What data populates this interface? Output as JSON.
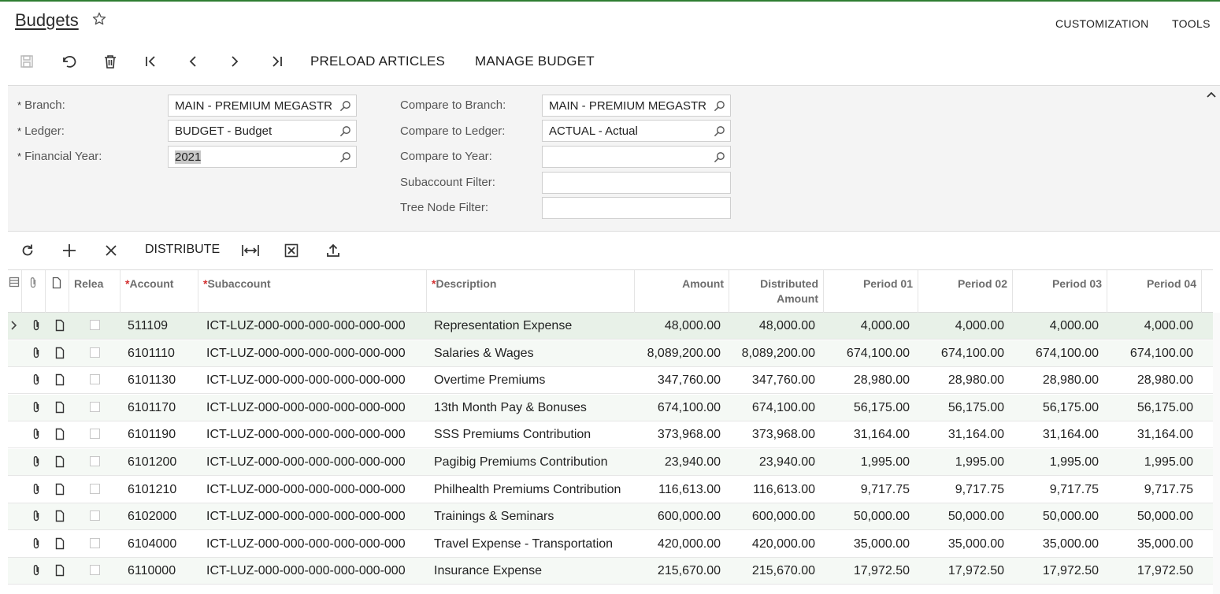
{
  "header": {
    "title": "Budgets",
    "customization": "CUSTOMIZATION",
    "tools": "TOOLS"
  },
  "toolbar": {
    "preload": "PRELOAD ARTICLES",
    "manage": "MANAGE BUDGET"
  },
  "form": {
    "branch_label": "Branch:",
    "branch_value": "MAIN - PREMIUM MEGASTR",
    "ledger_label": "Ledger:",
    "ledger_value": "BUDGET - Budget",
    "year_label": "Financial Year:",
    "year_value": "2021",
    "cmp_branch_label": "Compare to Branch:",
    "cmp_branch_value": "MAIN - PREMIUM MEGASTR",
    "cmp_ledger_label": "Compare to Ledger:",
    "cmp_ledger_value": "ACTUAL - Actual",
    "cmp_year_label": "Compare to Year:",
    "cmp_year_value": "",
    "subacct_label": "Subaccount Filter:",
    "subacct_value": "",
    "tree_label": "Tree Node Filter:",
    "tree_value": "",
    "required_mark": "*"
  },
  "grid": {
    "distribute": "DISTRIBUTE",
    "columns": {
      "released": "Relea",
      "account": "Account",
      "subaccount": "Subaccount",
      "description": "Description",
      "amount": "Amount",
      "distributed_1": "Distributed",
      "distributed_2": "Amount",
      "p01": "Period 01",
      "p02": "Period 02",
      "p03": "Period 03",
      "p04": "Period 04",
      "required_mark": "*"
    },
    "rows": [
      {
        "account": "511109",
        "sub": "ICT-LUZ-000-000-000-000-000-000",
        "desc": "Representation Expense",
        "amount": "48,000.00",
        "dist": "48,000.00",
        "p1": "4,000.00",
        "p2": "4,000.00",
        "p3": "4,000.00",
        "p4": "4,000.00"
      },
      {
        "account": "6101110",
        "sub": "ICT-LUZ-000-000-000-000-000-000",
        "desc": "Salaries & Wages",
        "amount": "8,089,200.00",
        "dist": "8,089,200.00",
        "p1": "674,100.00",
        "p2": "674,100.00",
        "p3": "674,100.00",
        "p4": "674,100.00"
      },
      {
        "account": "6101130",
        "sub": "ICT-LUZ-000-000-000-000-000-000",
        "desc": "Overtime Premiums",
        "amount": "347,760.00",
        "dist": "347,760.00",
        "p1": "28,980.00",
        "p2": "28,980.00",
        "p3": "28,980.00",
        "p4": "28,980.00"
      },
      {
        "account": "6101170",
        "sub": "ICT-LUZ-000-000-000-000-000-000",
        "desc": "13th Month Pay & Bonuses",
        "amount": "674,100.00",
        "dist": "674,100.00",
        "p1": "56,175.00",
        "p2": "56,175.00",
        "p3": "56,175.00",
        "p4": "56,175.00"
      },
      {
        "account": "6101190",
        "sub": "ICT-LUZ-000-000-000-000-000-000",
        "desc": "SSS Premiums Contribution",
        "amount": "373,968.00",
        "dist": "373,968.00",
        "p1": "31,164.00",
        "p2": "31,164.00",
        "p3": "31,164.00",
        "p4": "31,164.00"
      },
      {
        "account": "6101200",
        "sub": "ICT-LUZ-000-000-000-000-000-000",
        "desc": "Pagibig Premiums Contribution",
        "amount": "23,940.00",
        "dist": "23,940.00",
        "p1": "1,995.00",
        "p2": "1,995.00",
        "p3": "1,995.00",
        "p4": "1,995.00"
      },
      {
        "account": "6101210",
        "sub": "ICT-LUZ-000-000-000-000-000-000",
        "desc": "Philhealth Premiums Contribution",
        "amount": "116,613.00",
        "dist": "116,613.00",
        "p1": "9,717.75",
        "p2": "9,717.75",
        "p3": "9,717.75",
        "p4": "9,717.75"
      },
      {
        "account": "6102000",
        "sub": "ICT-LUZ-000-000-000-000-000-000",
        "desc": "Trainings & Seminars",
        "amount": "600,000.00",
        "dist": "600,000.00",
        "p1": "50,000.00",
        "p2": "50,000.00",
        "p3": "50,000.00",
        "p4": "50,000.00"
      },
      {
        "account": "6104000",
        "sub": "ICT-LUZ-000-000-000-000-000-000",
        "desc": "Travel Expense - Transportation",
        "amount": "420,000.00",
        "dist": "420,000.00",
        "p1": "35,000.00",
        "p2": "35,000.00",
        "p3": "35,000.00",
        "p4": "35,000.00"
      },
      {
        "account": "6110000",
        "sub": "ICT-LUZ-000-000-000-000-000-000",
        "desc": "Insurance Expense",
        "amount": "215,670.00",
        "dist": "215,670.00",
        "p1": "17,972.50",
        "p2": "17,972.50",
        "p3": "17,972.50",
        "p4": "17,972.50"
      }
    ]
  },
  "colors": {
    "accent": "#2e7d32",
    "required": "#d32f2f",
    "row_active": "#e8f1e8"
  }
}
